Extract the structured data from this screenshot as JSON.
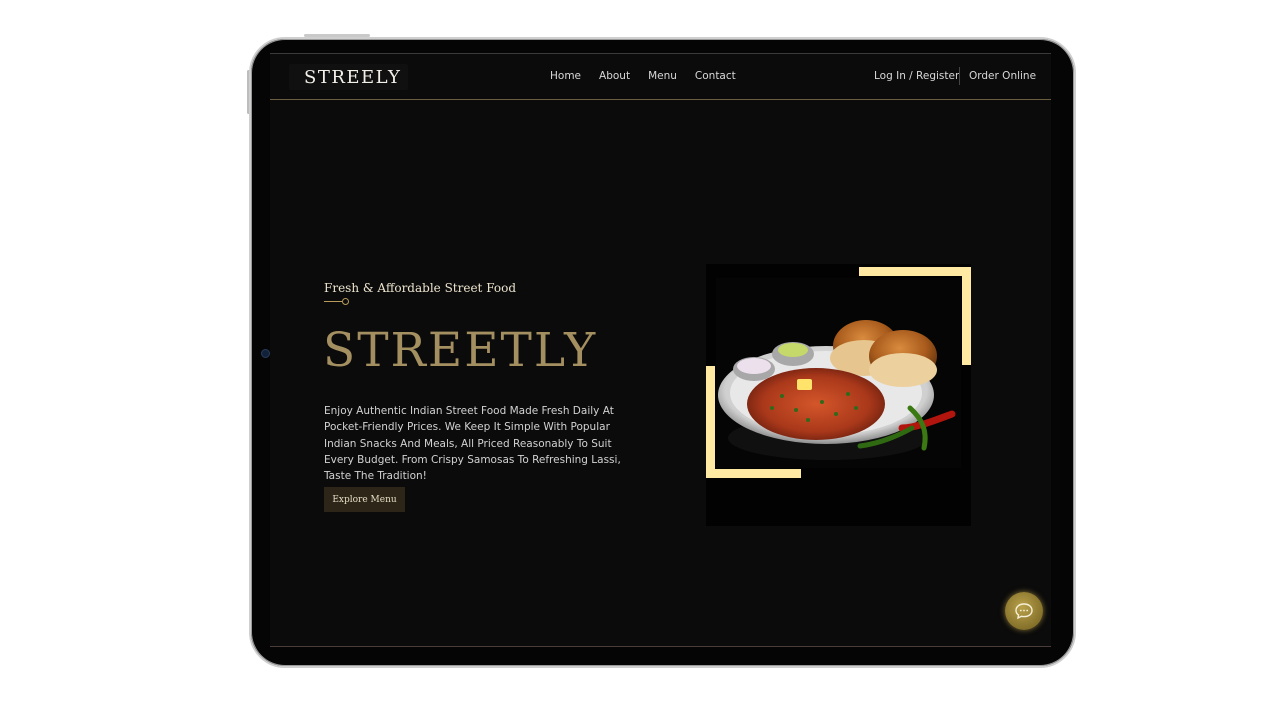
{
  "nav": {
    "brand": "STREELY",
    "links": [
      "Home",
      "About",
      "Menu",
      "Contact"
    ],
    "auth": "Log In / Register",
    "order": "Order Online"
  },
  "hero": {
    "tagline": "Fresh & Affordable Street Food",
    "title": "STREETLY",
    "description": "Enjoy Authentic Indian Street Food Made Fresh Daily At Pocket-Friendly Prices. We Keep It Simple With Popular Indian Snacks And Meals, All Priced Reasonably To Suit Every Budget. From Crispy Samosas To Refreshing Lassi, Taste The Tradition!",
    "cta": "Explore Menu"
  },
  "colors": {
    "accent_gold": "#a48f61",
    "frame_yellow": "#ffe9a3",
    "button_bg": "#2d2618"
  },
  "icons": {
    "chat": "chat-bubble-icon"
  }
}
